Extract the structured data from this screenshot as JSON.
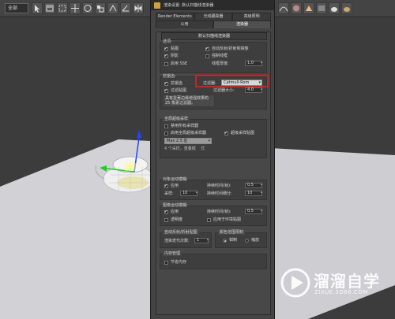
{
  "toolbar": {
    "selection_filter": "全部"
  },
  "dialog": {
    "title": "渲染设置: 默认扫描线渲染器",
    "tabs_row1": [
      "Render Elements",
      "光线跟踪器",
      "高级照明"
    ],
    "tabs_row2": [
      "公用",
      "渲染器"
    ],
    "active_tab": "渲染器",
    "renderer_group_title": "默认扫描线渲染器",
    "options": {
      "title": "选项:",
      "mapping": "贴图",
      "auto_reflect": "自动反射/折射和镜像",
      "shadows": "阴影",
      "force_wireframe": "强制线框",
      "enable_sse": "启用 SSE",
      "wire_thickness_label": "线框厚度:",
      "wire_thickness_value": "1.0"
    },
    "antialiasing": {
      "title": "抗锯齿:",
      "antialiasing": "抗锯齿",
      "filter_label": "过滤器:",
      "filter_value": "Catmull-Rom",
      "filter_maps": "过滤贴图",
      "filter_size_label": "过滤器大小:",
      "filter_size_value": "4.0",
      "description": "具有显著边缘增强效果的 25 像素过滤器。"
    },
    "supersampling": {
      "title": "全局超级采样",
      "disable_all": "禁用所有采样器",
      "enable_global": "启用全局超级采样器",
      "supersample_maps": "超级采样贴图",
      "sampler_value": "Max 2.5 星",
      "quality_label": "4 个采样，重叠模",
      "quality_value": "式"
    },
    "object_motion_blur": {
      "title": "对象运动模糊:",
      "apply": "应用",
      "duration_label": "持续时间(帧):",
      "duration_value": "0.5",
      "samples_label": "采样:",
      "samples_value": "10",
      "subdivisions_label": "持续时间细分:",
      "subdivisions_value": "10"
    },
    "image_motion_blur": {
      "title": "图像运动模糊:",
      "apply": "应用",
      "duration_label": "持续时间(帧):",
      "duration_value": "0.5",
      "transparency": "透明度",
      "apply_environment": "应用于环境贴图"
    },
    "auto_reflect_maps": {
      "title": "自动反射/折射贴图",
      "render_iterations_label": "渲染迭代次数:",
      "render_iterations_value": "1"
    },
    "color_range_limit": {
      "title": "颜色范围限制",
      "clamp": "钳制",
      "scale": "缩放"
    },
    "memory": {
      "title": "内存管理",
      "save_memory": "节省内存"
    }
  },
  "watermark": {
    "brand": "溜溜自学",
    "url": "ZIXUE.3D66.COM"
  }
}
